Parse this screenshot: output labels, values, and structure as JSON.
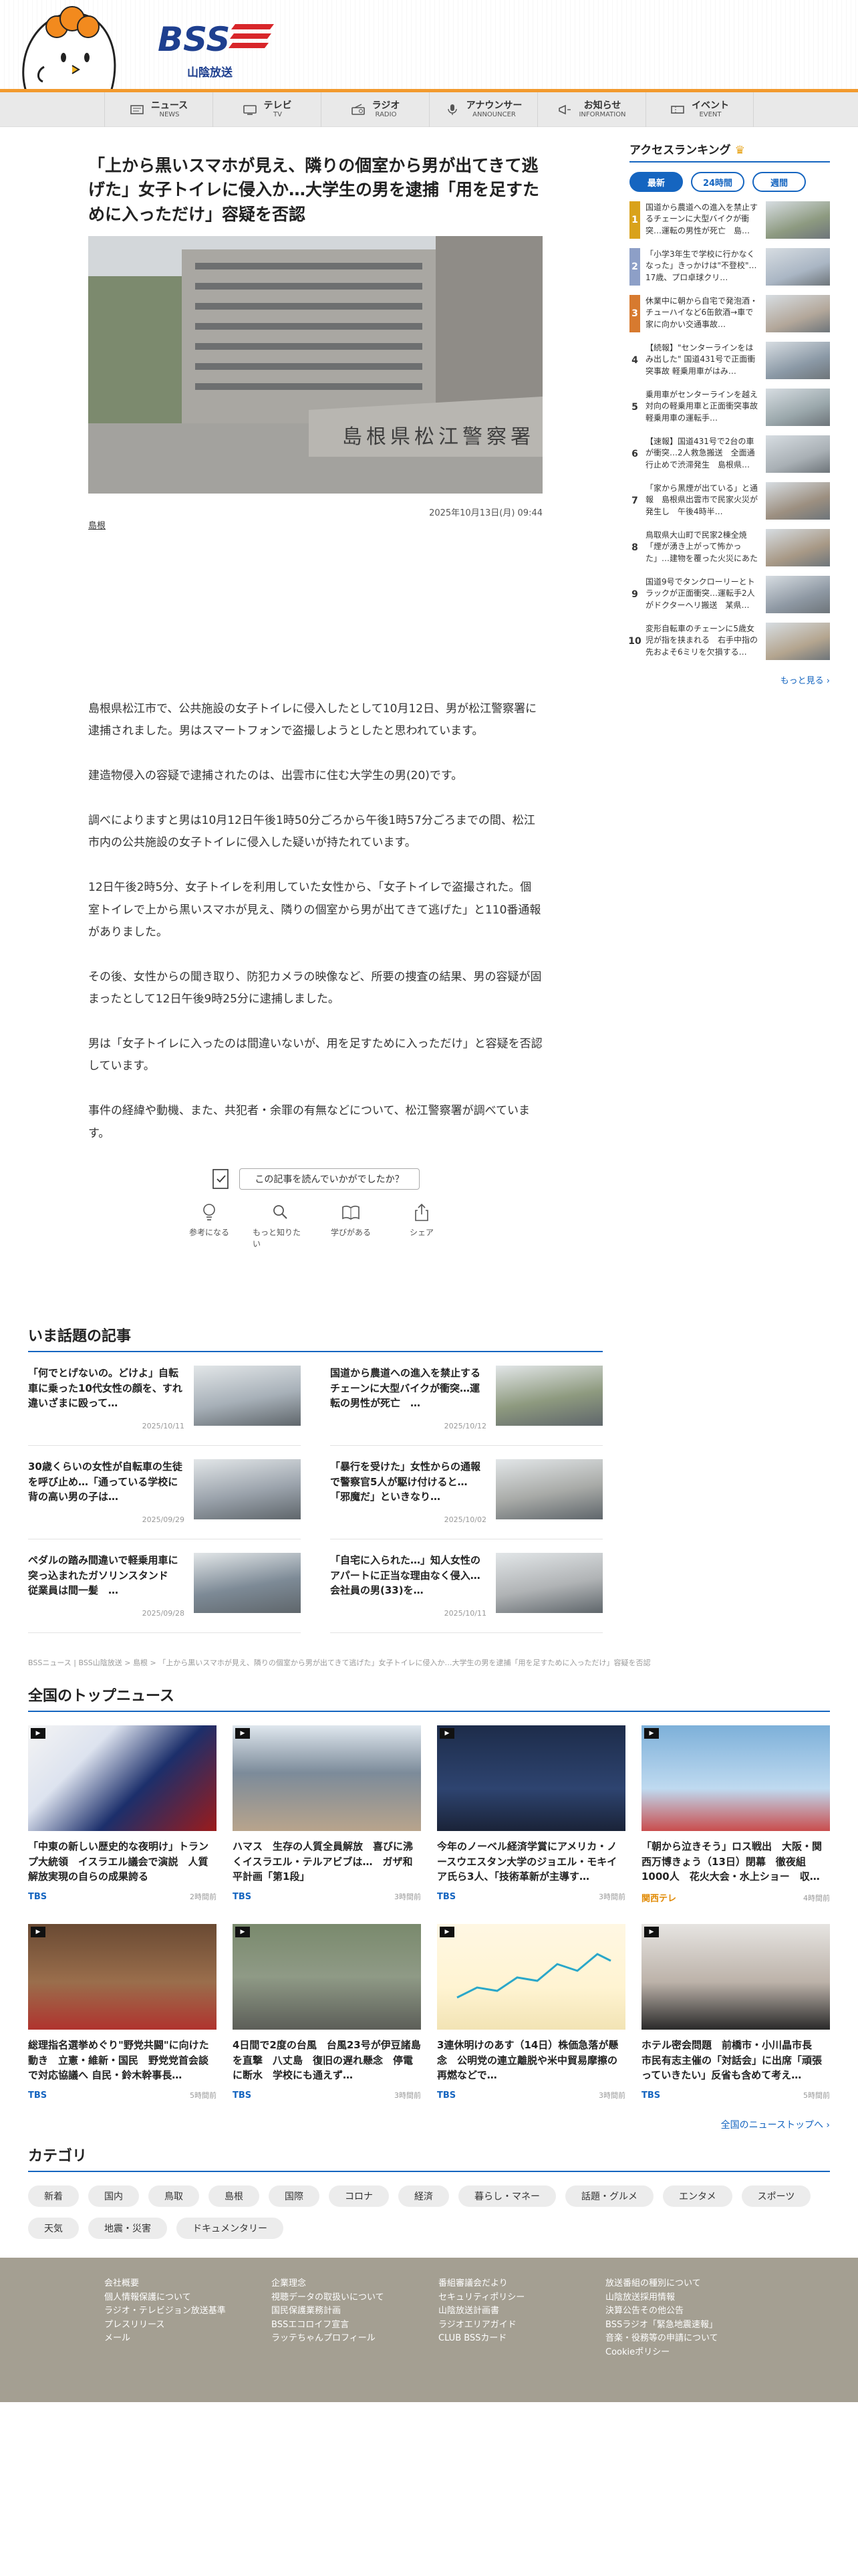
{
  "brand": {
    "logo_text": "BSS",
    "logo_sub": "山陰放送"
  },
  "nav": [
    {
      "jp": "ニュース",
      "en": "NEWS",
      "icon": "news-icon"
    },
    {
      "jp": "テレビ",
      "en": "TV",
      "icon": "tv-icon"
    },
    {
      "jp": "ラジオ",
      "en": "RADIO",
      "icon": "radio-icon"
    },
    {
      "jp": "アナウンサー",
      "en": "ANNOUNCER",
      "icon": "microphone-icon"
    },
    {
      "jp": "お知らせ",
      "en": "INFORMATION",
      "icon": "megaphone-icon"
    },
    {
      "jp": "イベント",
      "en": "EVENT",
      "icon": "ticket-icon"
    }
  ],
  "article": {
    "title": "「上から黒いスマホが見え、隣りの個室から男が出てきて逃げた」女子トイレに侵入か…大学生の男を逮捕「用を足すために入っただけ」容疑を否認",
    "photo_sign": "島根県松江警察署",
    "date": "2025年10月13日(月) 09:44",
    "area": "島根",
    "paragraphs": [
      "島根県松江市で、公共施設の女子トイレに侵入したとして10月12日、男が松江警察署に逮捕されました。男はスマートフォンで盗撮しようとしたと思われています。",
      "建造物侵入の容疑で逮捕されたのは、出雲市に住む大学生の男(20)です。",
      "調べによりますと男は10月12日午後1時50分ごろから午後1時57分ごろまでの間、松江市内の公共施設の女子トイレに侵入した疑いが持たれています。",
      "12日午後2時5分、女子トイレを利用していた女性から、「女子トイレで盗撮された。個室トイレで上から黒いスマホが見え、隣りの個室から男が出てきて逃げた」と110番通報がありました。",
      "その後、女性からの聞き取り、防犯カメラの映像など、所要の捜査の結果、男の容疑が固まったとして12日午後9時25分に逮捕しました。",
      "男は「女子トイレに入ったのは間違いないが、用を足すために入っただけ」と容疑を否認しています。",
      "事件の経緯や動機、また、共犯者・余罪の有無などについて、松江警察署が調べています。"
    ],
    "survey": "この記事を読んでいかがでしたか？",
    "reactions": [
      {
        "label": "参考になる",
        "icon": "lightbulb-icon"
      },
      {
        "label": "もっと知りたい",
        "icon": "magnifier-icon"
      },
      {
        "label": "学びがある",
        "icon": "book-icon"
      },
      {
        "label": "シェア",
        "icon": "share-icon"
      }
    ]
  },
  "ranking": {
    "title": "アクセスランキング",
    "tabs": [
      "最新",
      "24時間",
      "週間"
    ],
    "items": [
      {
        "rank": "1",
        "text": "国道から農道への進入を禁止するチェーンに大型バイクが衝突…運転の男性が死亡　島…"
      },
      {
        "rank": "2",
        "text": "「小学3年生で学校に行かなくなった」きっかけは\"不登校\"…17歳、プロ卓球クリ…"
      },
      {
        "rank": "3",
        "text": "休業中に朝から自宅で発泡酒・チューハイなど6缶飲酒→車で家に向かい交通事故…"
      },
      {
        "rank": "4",
        "text": "【続報】\"センターラインをはみ出した\" 国道431号で正面衝突事故 軽乗用車がはみ…"
      },
      {
        "rank": "5",
        "text": "乗用車がセンターラインを越え対向の軽乗用車と正面衝突事故 軽乗用車の運転手…"
      },
      {
        "rank": "6",
        "text": "【速報】国道431号で2台の車が衝突…2人救急搬送　全面通行止めで渋滞発生　島根県…"
      },
      {
        "rank": "7",
        "text": "「家から黒煙が出ている」と通報　島根県出雲市で民家火災が発生し　午後4時半…"
      },
      {
        "rank": "8",
        "text": "鳥取県大山町で民家2棟全焼「煙が湧き上がって怖かった」…建物を覆った火災にあたり…"
      },
      {
        "rank": "9",
        "text": "国道9号でタンクローリーとトラックが正面衝突…運転手2人がドクターヘリ搬送　某県…"
      },
      {
        "rank": "10",
        "text": "変形自転車のチェーンに5歳女児が指を挟まれる　右手中指の先およそ6ミリを欠損する…"
      }
    ],
    "more": "もっと見る ›"
  },
  "topics": {
    "title": "いま話題の記事",
    "items": [
      {
        "text": "「何でとげないの。どけよ」自転車に乗った10代女性の顔を、すれ違いざまに殴って…",
        "date": "2025/10/11"
      },
      {
        "text": "国道から農道への進入を禁止するチェーンに大型バイクが衝突…運転の男性が死亡　…",
        "date": "2025/10/12"
      },
      {
        "text": "30歳くらいの女性が自転車の生徒を呼び止め…「通っている学校に背の高い男の子は…",
        "date": "2025/09/29"
      },
      {
        "text": "「暴行を受けた」女性からの通報で警察官5人が駆け付けると…「邪魔だ」といきなり…",
        "date": "2025/10/02"
      },
      {
        "text": "ペダルの踏み間違いで軽乗用車に突っ込まれたガソリンスタンド　従業員は間一髪　…",
        "date": "2025/09/28"
      },
      {
        "text": "「自宅に入られた…」知人女性のアパートに正当な理由なく侵入…会社員の男(33)を…",
        "date": "2025/10/11"
      }
    ]
  },
  "breadcrumb": "BSSニュース | BSS山陰放送 > 島根 > 「上から黒いスマホが見え、隣りの個室から男が出てきて逃げた」女子トイレに侵入か…大学生の男を逮捕「用を足すために入っただけ」容疑を否認",
  "top_news": {
    "title": "全国のトップニュース",
    "items": [
      {
        "text": "「中東の新しい歴史的な夜明け」トランプ大統領　イスラエル議会で演説　人質解放実現の自らの成果誇る",
        "src": "TBS",
        "time": "2時間前",
        "src_color": "blue",
        "img": "trump"
      },
      {
        "text": "ハマス　生存の人質全員解放　喜びに沸くイスラエル・テルアビブは…　ガザ和平計画「第1段」",
        "src": "TBS",
        "time": "3時間前",
        "src_color": "blue",
        "img": "crowd"
      },
      {
        "text": "今年のノーベル経済学賞にアメリカ・ノースウエスタン大学のジョエル・モキイア氏ら3人、「技術革新が主導す…",
        "src": "TBS",
        "time": "3時間前",
        "src_color": "blue",
        "img": "nobel"
      },
      {
        "text": "「朝から泣きそう」ロス戦出　大阪・関西万博きょう（13日）閉幕　徹夜組1000人　花火大会・水上ショー　収…",
        "src": "関西テレ",
        "time": "4時間前",
        "src_color": "orange",
        "img": "expo"
      },
      {
        "text": "総理指名選挙めぐり\"野党共闘\"に向けた動き　立憲・維新・国民　野党党首会談で対応協議へ 自民・鈴木幹事長…",
        "src": "TBS",
        "time": "5時間前",
        "src_color": "blue",
        "img": "diet"
      },
      {
        "text": "4日間で2度の台風　台風23号が伊豆諸島を直撃　八丈島　復旧の遅れ懸念　停電に断水　学校にも通えず…",
        "src": "TBS",
        "time": "3時間前",
        "src_color": "blue",
        "img": "typhoon"
      },
      {
        "text": "3連休明けのあす（14日）株価急落が懸念　公明党の連立離脱や米中貿易摩擦の再燃などで…",
        "src": "TBS",
        "time": "3時間前",
        "src_color": "blue",
        "img": "chart"
      },
      {
        "text": "ホテル密会問題　前橋市・小川晶市長　市民有志主催の「対話会」に出席「頑張っていきたい」反省も含めて考え…",
        "src": "TBS",
        "time": "5時間前",
        "src_color": "blue",
        "img": "mayor"
      }
    ],
    "more": "全国のニューストップへ ›"
  },
  "categories": {
    "title": "カテゴリ",
    "items": [
      "新着",
      "国内",
      "鳥取",
      "島根",
      "国際",
      "コロナ",
      "経済",
      "暮らし・マネー",
      "話題・グルメ",
      "エンタメ",
      "スポーツ",
      "天気",
      "地震・災害",
      "ドキュメンタリー"
    ]
  },
  "footer": {
    "cols": [
      [
        "会社概要",
        "個人情報保護について",
        "ラジオ・テレビジョン放送基準",
        "プレスリリース",
        "メール"
      ],
      [
        "企業理念",
        "視聴データの取扱いについて",
        "国民保護業務計画",
        "BSSエコロイフ宣言",
        "ラッテちゃんプロフィール"
      ],
      [
        "番組審議会だより",
        "セキュリティポリシー",
        "山陰放送計画書",
        "ラジオエリアガイド",
        "CLUB BSSカード"
      ],
      [
        "放送番組の種別について",
        "山陰放送採用情報",
        "決算公告その他公告",
        "BSSラジオ「緊急地震速報」",
        "音楽・役務等の申請について",
        "Cookieポリシー"
      ]
    ]
  },
  "colors": {
    "accent": "#1565c0",
    "orange": "#f29a2e",
    "footer": "#a49f92"
  }
}
